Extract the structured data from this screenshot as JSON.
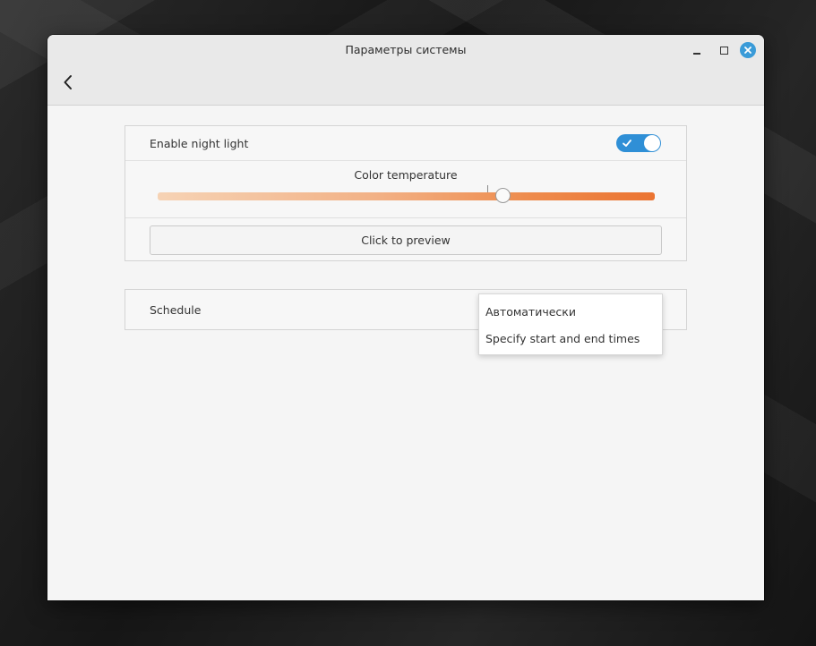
{
  "window": {
    "title": "Параметры системы"
  },
  "night_light": {
    "enable_label": "Enable night light",
    "enabled": true,
    "color_temperature_label": "Color temperature",
    "color_temperature_level": 0.7,
    "preview_label": "Click to preview"
  },
  "schedule": {
    "label": "Schedule",
    "options": [
      "Автоматически",
      "Specify start and end times"
    ]
  },
  "colors": {
    "accent": "#2f8fd6",
    "close_button": "#3a9bd8",
    "slider_start": "#f6d3b5",
    "slider_end": "#eb7432"
  },
  "icons": {
    "back": "chevron-left-icon",
    "minimize": "minimize-icon",
    "maximize": "maximize-icon",
    "close": "close-icon",
    "toggle_check": "check-icon"
  }
}
